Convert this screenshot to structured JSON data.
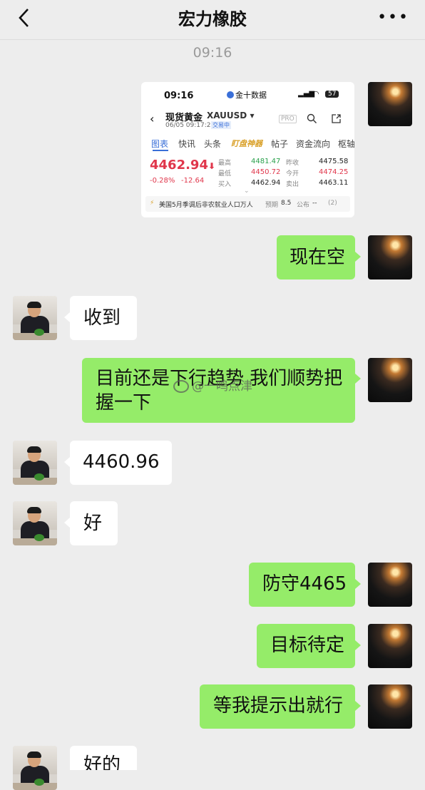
{
  "header": {
    "title": "宏力橡胶",
    "more": "•••"
  },
  "timestamp": "09:16",
  "screenshot": {
    "status_time": "09:16",
    "app_name": "金十数据",
    "battery": "57",
    "symbol_name": "现货黄金",
    "symbol_code": "XAUUSD",
    "datetime": "06/05 09:17:29",
    "trading_status": "交易中",
    "pro_badge": "PRO",
    "tabs": [
      "图表",
      "快讯",
      "头条",
      "盯盘神器",
      "帖子",
      "资金流向",
      "枢轴"
    ],
    "price": "4462.94",
    "change_pct": "-0.28%",
    "change_abs": "-12.64",
    "stats": {
      "high_label": "最高",
      "high": "4481.47",
      "low_label": "最低",
      "low": "4450.72",
      "bid_label": "买入",
      "bid": "4462.94",
      "prev_label": "昨收",
      "prev": "4475.58",
      "open_label": "今开",
      "open": "4474.25",
      "ask_label": "卖出",
      "ask": "4463.11"
    },
    "news": {
      "text": "美国5月季调后非农就业人口万人",
      "forecast_label": "预期",
      "forecast": "8.5",
      "actual_label": "公布",
      "actual": "--",
      "count": "(2)"
    }
  },
  "messages": [
    {
      "side": "me",
      "text": "现在空"
    },
    {
      "side": "other",
      "text": "收到"
    },
    {
      "side": "me",
      "text": "目前还是下行趋势 我们顺势把握一下"
    },
    {
      "side": "other",
      "text": "4460.96"
    },
    {
      "side": "other",
      "text": "好"
    },
    {
      "side": "me",
      "text": "防守4465"
    },
    {
      "side": "me",
      "text": "目标待定"
    },
    {
      "side": "me",
      "text": "等我提示出就行"
    },
    {
      "side": "other",
      "text": "好的"
    }
  ],
  "watermark": "一鸣点津",
  "colors": {
    "bubble_me": "#95ec69",
    "bubble_other": "#ffffff",
    "background": "#ededed",
    "price_down": "#e0364b",
    "price_up": "#2aa14c",
    "tab_active": "#3a6fd8"
  }
}
